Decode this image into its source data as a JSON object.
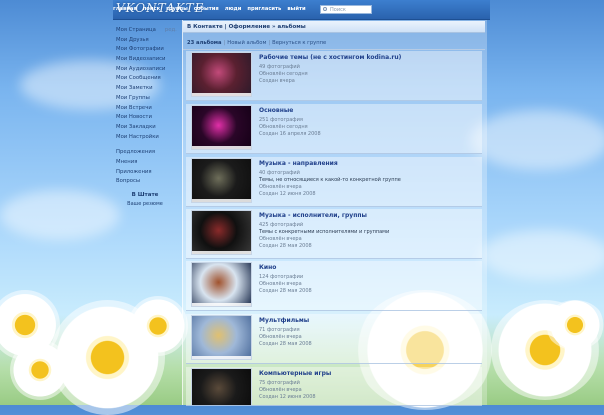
{
  "header": {
    "logo": "VKONTAKTE",
    "nav": [
      "главная",
      "поиск",
      "группы",
      "события",
      "люди",
      "пригласить",
      "выйти"
    ],
    "search_placeholder": "Поиск"
  },
  "sidebar": {
    "items": [
      "Моя Страница",
      "Мои Друзья",
      "Мои Фотографии",
      "Мои Видеозаписи",
      "Мои Аудиозаписи",
      "Мои Сообщения",
      "Мои Заметки",
      "Мои Группы",
      "Мои Встречи",
      "Мои Новости",
      "Мои Закладки",
      "Мои Настройки"
    ],
    "edit_label": "ред.",
    "extra": [
      "Предложения",
      "Мнения",
      "Приложения",
      "Вопросы"
    ],
    "state_title": "В Штате",
    "state_sub": "Ваше резюме"
  },
  "breadcrumb": "В Контакте | Оформление » альбомы",
  "toolbar": {
    "count": "23 альбома",
    "new_album": "Новый альбом",
    "back": "Вернуться к группе"
  },
  "albums": [
    {
      "title": "Рабочие темы (не с хостингом kodina.ru)",
      "count": "49 фотографий",
      "desc": "",
      "updated": "Обновлён сегодня",
      "created": "Создан вчера",
      "colors": [
        "#5a2030",
        "#c24a7a",
        "#2b1a2a"
      ]
    },
    {
      "title": "Основные",
      "count": "251 фотография",
      "desc": "",
      "updated": "Обновлён сегодня",
      "created": "Создан 16 апреля 2008",
      "colors": [
        "#2a0628",
        "#e12fa8",
        "#140016"
      ]
    },
    {
      "title": "Музыка - направления",
      "count": "40 фотографий",
      "desc": "Темы, не относящиеся к какой-то конкретной группе",
      "updated": "Обновлён вчера",
      "created": "Создан 12 июня 2008",
      "colors": [
        "#1b1b1b",
        "#6e6e5a",
        "#0e0e0e"
      ]
    },
    {
      "title": "Музыка - исполнители, группы",
      "count": "425 фотографий",
      "desc": "Темы с конкретными исполнителями и группами",
      "updated": "Обновлён вчера",
      "created": "Создан 28 мая 2008",
      "colors": [
        "#101010",
        "#8a2a2a",
        "#3a3a3a"
      ]
    },
    {
      "title": "Кино",
      "count": "124 фотографии",
      "desc": "",
      "updated": "Обновлён вчера",
      "created": "Создан 28 мая 2008",
      "colors": [
        "#d8e4f0",
        "#a0522d",
        "#1a2a4a"
      ]
    },
    {
      "title": "Мультфильмы",
      "count": "71 фотография",
      "desc": "",
      "updated": "Обновлён вчера",
      "created": "Создан 28 мая 2008",
      "colors": [
        "#9fb8d8",
        "#e0c070",
        "#4a6a9a"
      ]
    },
    {
      "title": "Компьютерные игры",
      "count": "75 фотографий",
      "desc": "",
      "updated": "Обновлён вчера",
      "created": "Создан 12 июня 2008",
      "colors": [
        "#1a1a1a",
        "#5a4a3a",
        "#0a0a0a"
      ]
    }
  ]
}
